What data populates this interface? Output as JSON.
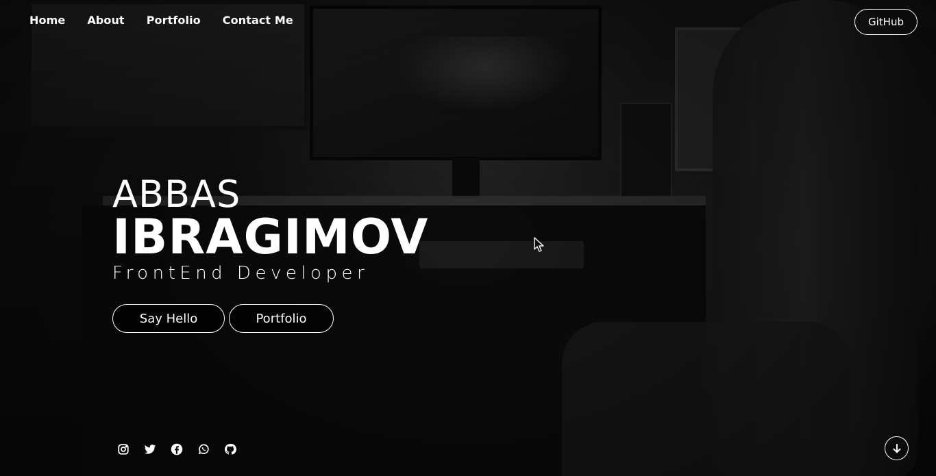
{
  "nav": {
    "items": [
      {
        "label": "Home"
      },
      {
        "label": "About"
      },
      {
        "label": "Portfolio"
      },
      {
        "label": "Contact Me"
      }
    ],
    "github_label": "GitHub"
  },
  "hero": {
    "first_name": "ABBAS",
    "last_name": "IBRAGIMOV",
    "role": "FrontEnd Developer",
    "say_hello_label": "Say Hello",
    "portfolio_label": "Portfolio"
  },
  "socials": [
    "instagram-icon",
    "twitter-icon",
    "facebook-icon",
    "whatsapp-icon",
    "github-icon"
  ],
  "scroll_icon": "arrow-down-icon",
  "colors": {
    "text": "#ffffff",
    "background": "#0a0a0a"
  }
}
